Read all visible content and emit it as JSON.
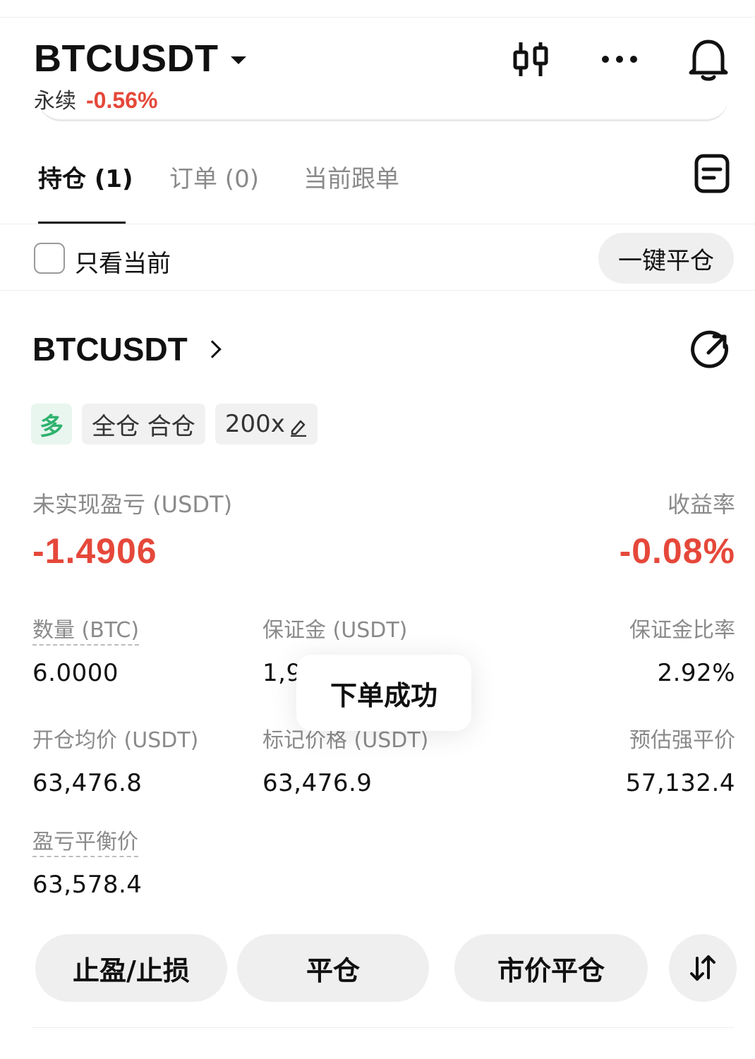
{
  "header": {
    "symbol": "BTCUSDT",
    "contract_type": "永续",
    "change_pct": "-0.56%",
    "icons": [
      "candlestick-chart-icon",
      "more-icon",
      "bell-icon"
    ]
  },
  "tabs": [
    {
      "label": "持仓 (1)",
      "active": true
    },
    {
      "label": "订单 (0)",
      "active": false
    },
    {
      "label": "当前跟单",
      "active": false
    }
  ],
  "filter": {
    "checkbox_label": "只看当前",
    "checked": false,
    "close_all_label": "一键平仓"
  },
  "position": {
    "symbol": "BTCUSDT",
    "tags": {
      "side": "多",
      "margin_mode": "全仓 合仓",
      "leverage": "200x"
    },
    "pnl_label": "未实现盈亏 (USDT)",
    "pnl_value": "-1.4906",
    "roe_label": "收益率",
    "roe_value": "-0.08%",
    "fields": {
      "qty_label": "数量 (BTC)",
      "qty_value": "6.0000",
      "margin_label": "保证金 (USDT)",
      "margin_value": "1,9",
      "margin_ratio_label": "保证金比率",
      "margin_ratio_value": "2.92%",
      "entry_label": "开仓均价 (USDT)",
      "entry_value": "63,476.8",
      "mark_label": "标记价格 (USDT)",
      "mark_value": "63,476.9",
      "liq_label": "预估强平价",
      "liq_value": "57,132.4",
      "breakeven_label": "盈亏平衡价",
      "breakeven_value": "63,578.4"
    }
  },
  "toast": {
    "message": "下单成功"
  },
  "actions": {
    "tp_sl": "止盈/止损",
    "close": "平仓",
    "market_close": "市价平仓"
  },
  "colors": {
    "negative": "#e5483a",
    "long": "#2fb26d",
    "button_bg": "#efefef"
  }
}
